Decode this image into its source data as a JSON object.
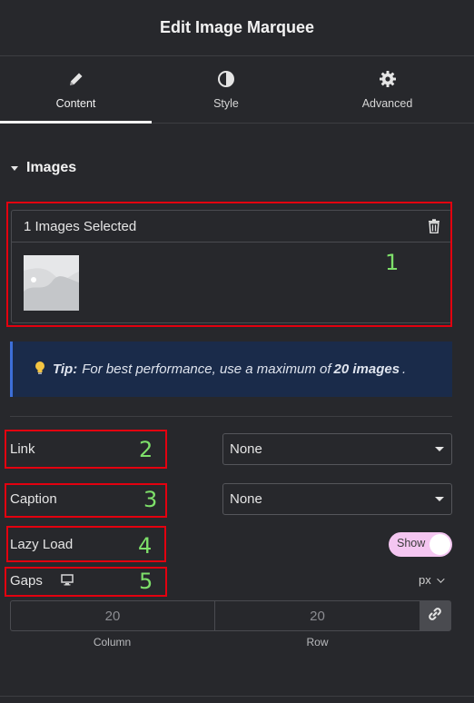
{
  "header": {
    "title": "Edit Image Marquee"
  },
  "tabs": [
    {
      "label": "Content",
      "icon": "pencil-icon",
      "active": true
    },
    {
      "label": "Style",
      "icon": "half-circle-icon",
      "active": false
    },
    {
      "label": "Advanced",
      "icon": "gear-icon",
      "active": false
    }
  ],
  "section": {
    "title": "Images"
  },
  "gallery": {
    "count_label": "1 Images Selected"
  },
  "tip": {
    "label": "Tip:",
    "text_before": "For best performance, use a maximum of",
    "strong": "20 images",
    "text_after": "."
  },
  "controls": {
    "link": {
      "label": "Link",
      "value": "None"
    },
    "caption": {
      "label": "Caption",
      "value": "None"
    },
    "lazy_load": {
      "label": "Lazy Load",
      "toggle_text": "Show"
    },
    "gaps": {
      "label": "Gaps",
      "unit": "px",
      "column_value": "20",
      "row_value": "20",
      "column_label": "Column",
      "row_label": "Row"
    }
  },
  "annotations": [
    "1",
    "2",
    "3",
    "4",
    "5"
  ],
  "colors": {
    "background": "#27282c",
    "annotation_box": "#e3000f",
    "annotation_number": "#7ee06a",
    "tip_background": "#1a2b4a",
    "toggle_on": "#f4c6f1"
  }
}
